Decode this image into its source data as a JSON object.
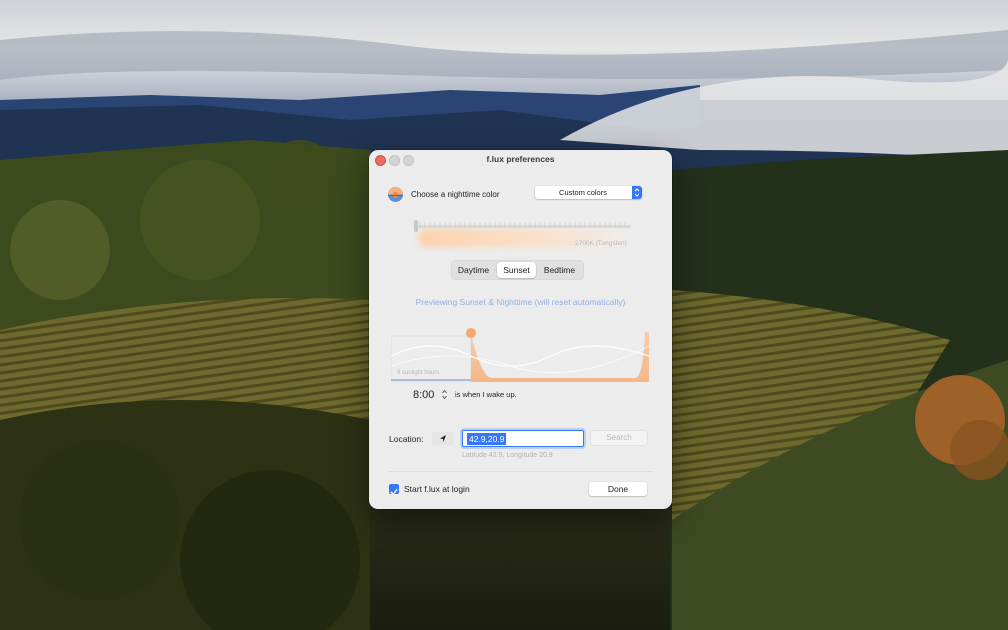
{
  "window": {
    "title": "f.lux preferences"
  },
  "color_section": {
    "label": "Choose a nighttime color",
    "selected_option": "Custom colors",
    "temperature_label": "2700K (Tungsten)",
    "icon": "sunset-icon"
  },
  "mode_tabs": {
    "items": [
      "Daytime",
      "Sunset",
      "Bedtime"
    ],
    "selected": "Sunset"
  },
  "preview_text": "Previewing Sunset & Nighttime (will reset automatically)",
  "schedule": {
    "sunlight_label": "9 sunlight hours",
    "wake_time": "8:00",
    "wake_suffix": "is when I wake up."
  },
  "location": {
    "label": "Location:",
    "value": "42.9,20.9",
    "search_label": "Search",
    "coords_text": "Latitude 42.9, Longitude 20.9",
    "locate_icon": "location-arrow-icon"
  },
  "footer": {
    "start_at_login_label": "Start f.lux at login",
    "start_at_login_checked": true,
    "done_label": "Done"
  },
  "colors": {
    "accent": "#3478f6",
    "close": "#ed6a5e",
    "preview_text": "#8fb0e0",
    "sunset_orange": "#f6b17e"
  }
}
